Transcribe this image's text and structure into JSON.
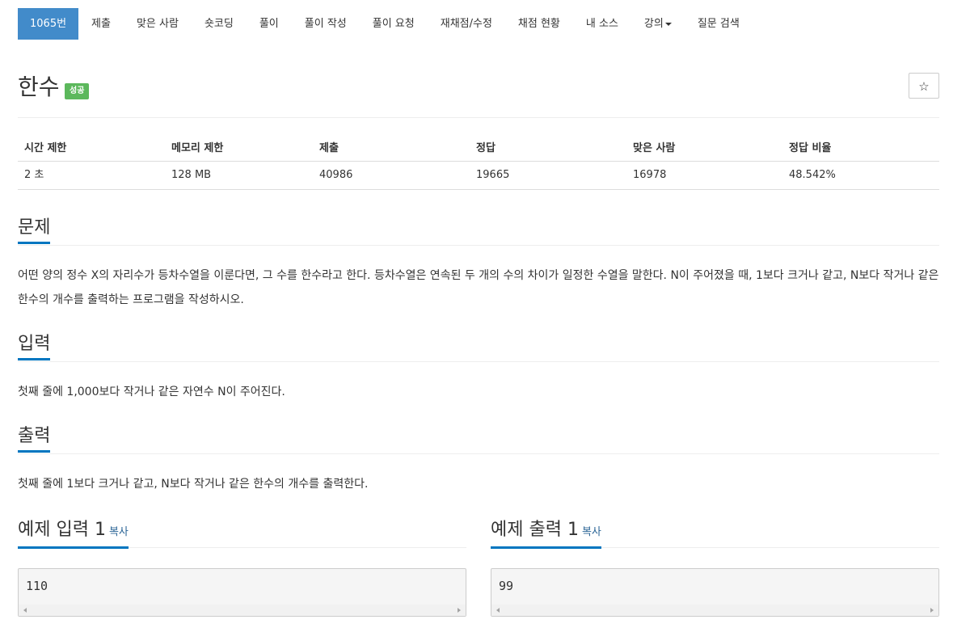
{
  "nav": {
    "items": [
      {
        "label": "1065번"
      },
      {
        "label": "제출"
      },
      {
        "label": "맞은 사람"
      },
      {
        "label": "숏코딩"
      },
      {
        "label": "풀이"
      },
      {
        "label": "풀이 작성"
      },
      {
        "label": "풀이 요청"
      },
      {
        "label": "재채점/수정"
      },
      {
        "label": "채점 현황"
      },
      {
        "label": "내 소스"
      },
      {
        "label": "강의"
      },
      {
        "label": "질문 검색"
      }
    ],
    "active_index": 0
  },
  "problem": {
    "title": "한수",
    "badge": "성공",
    "star_icon": "☆"
  },
  "stats": {
    "headers": [
      "시간 제한",
      "메모리 제한",
      "제출",
      "정답",
      "맞은 사람",
      "정답 비율"
    ],
    "values": [
      "2 초",
      "128 MB",
      "40986",
      "19665",
      "16978",
      "48.542%"
    ]
  },
  "sections": {
    "problem": {
      "heading": "문제",
      "text": "어떤 양의 정수 X의 자리수가 등차수열을 이룬다면, 그 수를 한수라고 한다. 등차수열은 연속된 두 개의 수의 차이가 일정한 수열을 말한다. N이 주어졌을 때, 1보다 크거나 같고, N보다 작거나 같은 한수의 개수를 출력하는 프로그램을 작성하시오."
    },
    "input": {
      "heading": "입력",
      "text": "첫째 줄에 1,000보다 작거나 같은 자연수 N이 주어진다."
    },
    "output": {
      "heading": "출력",
      "text": "첫째 줄에 1보다 크거나 같고, N보다 작거나 같은 한수의 개수를 출력한다."
    }
  },
  "samples": {
    "input": {
      "heading": "예제 입력 1",
      "copy": "복사",
      "code": "110"
    },
    "output": {
      "heading": "예제 출력 1",
      "copy": "복사",
      "code": "99"
    }
  },
  "colors": {
    "active_tab": "#428bca",
    "badge_success": "#5cb85c",
    "section_underline": "#0076c0",
    "copy_link": "#2a6496"
  }
}
